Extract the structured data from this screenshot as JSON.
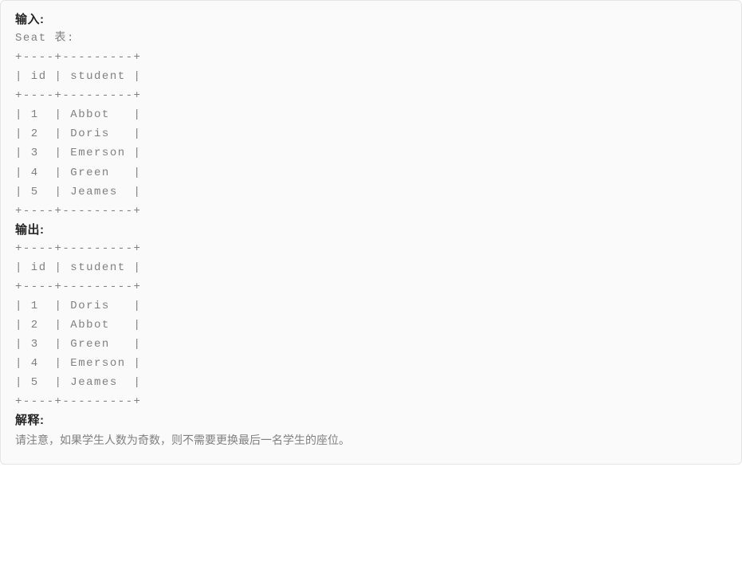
{
  "labels": {
    "input": "输入:",
    "output": "输出:",
    "explanation": "解释:"
  },
  "input_preamble": "Seat 表:",
  "table_borders": {
    "sep": "+----+---------+",
    "header": "| id | student |"
  },
  "input_rows": [
    "| 1  | Abbot   |",
    "| 2  | Doris   |",
    "| 3  | Emerson |",
    "| 4  | Green   |",
    "| 5  | Jeames  |"
  ],
  "output_rows": [
    "| 1  | Doris   |",
    "| 2  | Abbot   |",
    "| 3  | Green   |",
    "| 4  | Emerson |",
    "| 5  | Jeames  |"
  ],
  "explanation_text": "请注意，如果学生人数为奇数，则不需要更换最后一名学生的座位。"
}
